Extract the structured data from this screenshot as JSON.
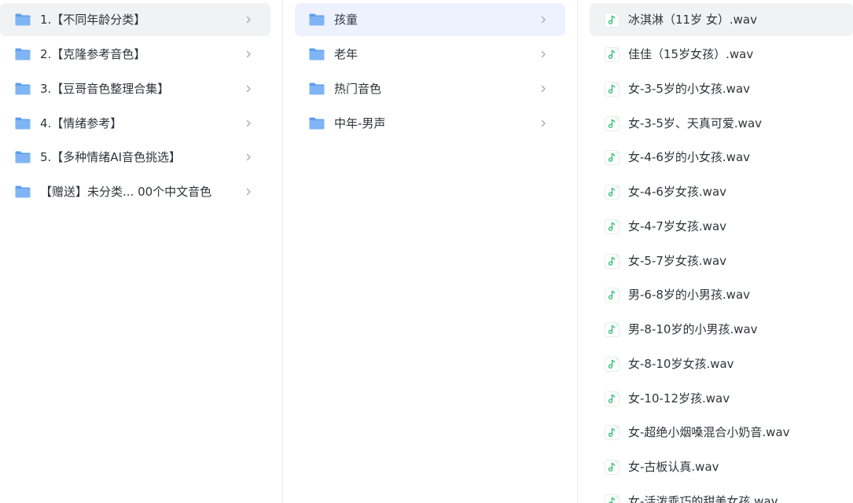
{
  "column_1": {
    "items": [
      {
        "label": "1.【不同年龄分类】",
        "selected": true
      },
      {
        "label": "2.【克隆参考音色】",
        "selected": false
      },
      {
        "label": "3.【豆哥音色整理合集】",
        "selected": false
      },
      {
        "label": "4.【情绪参考】",
        "selected": false
      },
      {
        "label": "5.【多种情绪AI音色挑选】",
        "selected": false
      },
      {
        "label": "【赠送】未分类... 00个中文音色",
        "selected": false
      }
    ]
  },
  "column_2": {
    "items": [
      {
        "label": "孩童",
        "selected": true
      },
      {
        "label": "老年",
        "selected": false
      },
      {
        "label": "热门音色",
        "selected": false
      },
      {
        "label": "中年-男声",
        "selected": false
      }
    ]
  },
  "column_3": {
    "items": [
      {
        "label": "冰淇淋（11岁 女）.wav",
        "selected": true
      },
      {
        "label": "佳佳（15岁女孩）.wav",
        "selected": false
      },
      {
        "label": "女-3-5岁的小女孩.wav",
        "selected": false
      },
      {
        "label": "女-3-5岁、天真可爱.wav",
        "selected": false
      },
      {
        "label": "女-4-6岁的小女孩.wav",
        "selected": false
      },
      {
        "label": "女-4-6岁女孩.wav",
        "selected": false
      },
      {
        "label": "女-4-7岁女孩.wav",
        "selected": false
      },
      {
        "label": "女-5-7岁女孩.wav",
        "selected": false
      },
      {
        "label": "男-6-8岁的小男孩.wav",
        "selected": false
      },
      {
        "label": "男-8-10岁的小男孩.wav",
        "selected": false
      },
      {
        "label": "女-8-10岁女孩.wav",
        "selected": false
      },
      {
        "label": "女-10-12岁孩.wav",
        "selected": false
      },
      {
        "label": "女-超绝小烟嗓混合小奶音.wav",
        "selected": false
      },
      {
        "label": "女-古板认真.wav",
        "selected": false
      },
      {
        "label": "女-活泼乖巧的甜美女孩.wav",
        "selected": false
      }
    ]
  },
  "icons": {
    "folder": "folder-icon",
    "audio": "audio-file-icon",
    "chevron": "chevron-right-icon"
  },
  "colors": {
    "folder_front": "#7fb5f5",
    "folder_back": "#5d9eef",
    "audio_accent": "#37c077",
    "selected_gray": "#f1f2f4",
    "selected_blue": "#eef2fe",
    "chevron": "#a3a8b0"
  }
}
